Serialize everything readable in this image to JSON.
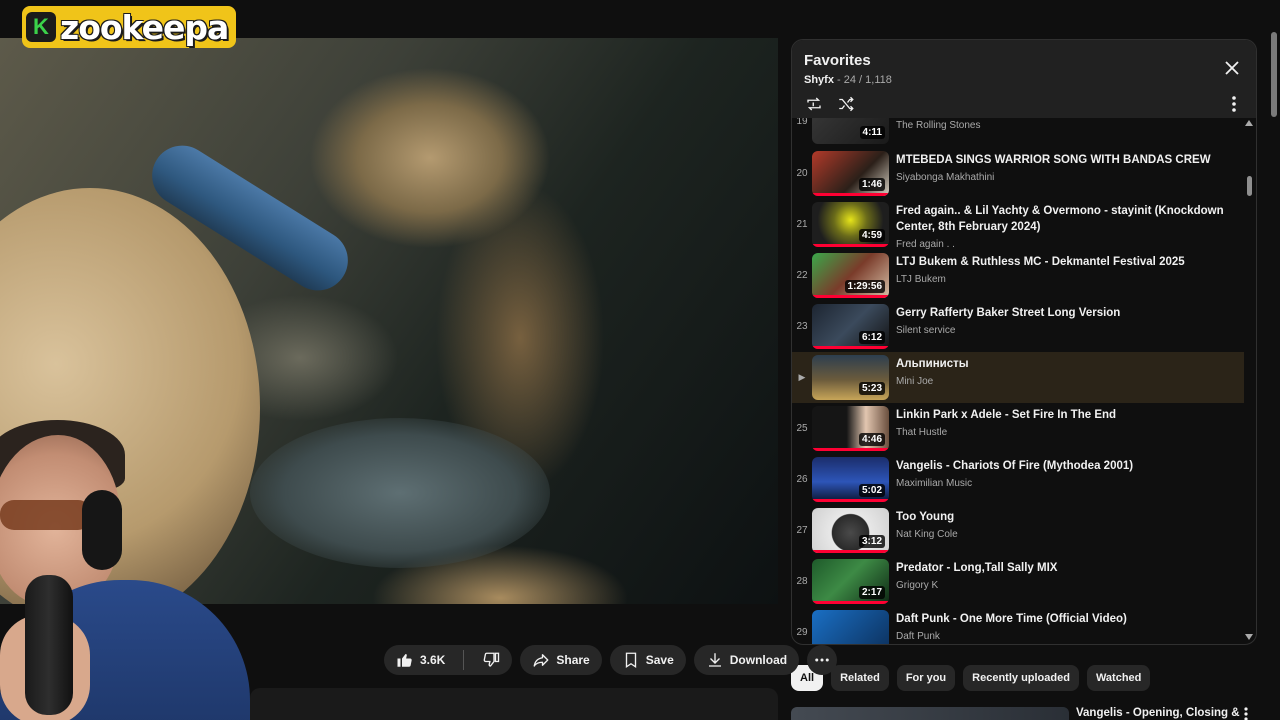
{
  "logo": {
    "badge": "K",
    "text": "zookeepa"
  },
  "actions": {
    "like_count": "3.6K",
    "share_label": "Share",
    "save_label": "Save",
    "download_label": "Download"
  },
  "playlist": {
    "title": "Favorites",
    "owner": "Shyfx",
    "position": " - 24 / 1,118",
    "items": [
      {
        "index": "19",
        "title": "",
        "channel": "The Rolling Stones",
        "duration": "4:11"
      },
      {
        "index": "20",
        "title": "MTEBEDA SINGS WARRIOR SONG WITH BANDAS CREW",
        "channel": "Siyabonga Makhathini",
        "duration": "1:46"
      },
      {
        "index": "21",
        "title": "Fred again.. & Lil Yachty & Overmono - stayinit (Knockdown Center, 8th February 2024)",
        "channel": "Fred again . .",
        "duration": "4:59"
      },
      {
        "index": "22",
        "title": "LTJ Bukem & Ruthless MC - Dekmantel Festival 2025",
        "channel": "LTJ Bukem",
        "duration": "1:29:56"
      },
      {
        "index": "23",
        "title": "Gerry Rafferty Baker Street Long Version",
        "channel": "Silent service",
        "duration": "6:12"
      },
      {
        "index": "▶",
        "title": "Альпинисты",
        "channel": "Mini Joe",
        "duration": "5:23"
      },
      {
        "index": "25",
        "title": "Linkin Park x Adele - Set Fire In The End",
        "channel": "That Hustle",
        "duration": "4:46"
      },
      {
        "index": "26",
        "title": "Vangelis - Chariots Of Fire (Mythodea 2001)",
        "channel": "Maximilian Music",
        "duration": "5:02"
      },
      {
        "index": "27",
        "title": "Too Young",
        "channel": "Nat King Cole",
        "duration": "3:12"
      },
      {
        "index": "28",
        "title": "Predator - Long,Tall Sally MIX",
        "channel": "Grigory K",
        "duration": "2:17"
      },
      {
        "index": "29",
        "title": "Daft Punk - One More Time (Official Video)",
        "channel": "Daft Punk",
        "duration": ""
      }
    ]
  },
  "chips": [
    "All",
    "Related",
    "For you",
    "Recently uploaded",
    "Watched"
  ],
  "recommendation": {
    "title": "Vangelis - Opening, Closing &"
  },
  "colors": {
    "accent": "#ff0033",
    "panel_header": "#212121",
    "active_row": "#2b2418",
    "logo_yellow": "#f0c419"
  }
}
